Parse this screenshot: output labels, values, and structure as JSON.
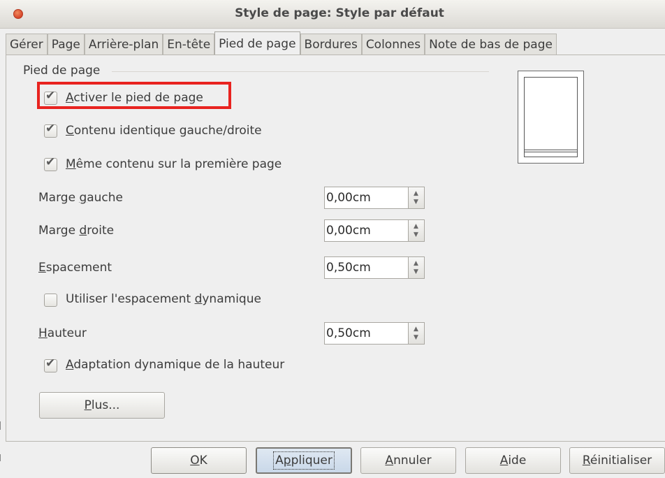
{
  "window": {
    "title": "Style de page: Style par défaut"
  },
  "tabs": [
    {
      "label": "Gérer"
    },
    {
      "label": "Page"
    },
    {
      "label": "Arrière-plan"
    },
    {
      "label": "En-tête"
    },
    {
      "label": "Pied de page"
    },
    {
      "label": "Bordures"
    },
    {
      "label": "Colonnes"
    },
    {
      "label": "Note de bas de page"
    }
  ],
  "active_tab": "Pied de page",
  "footer": {
    "section_label": "Pied de page",
    "activate": {
      "label_mn": "A",
      "label_rest": "ctiver le pied de page",
      "checked": true
    },
    "same_lr": {
      "label_mn": "C",
      "label_rest": "ontenu identique gauche/droite",
      "checked": true
    },
    "same_first": {
      "label_mn": "M",
      "label_rest": "ême contenu sur la première page",
      "checked": true
    },
    "left_margin": {
      "label_pre": "Marge ",
      "label_mn": "g",
      "label_post": "auche",
      "value": "0,00cm"
    },
    "right_margin": {
      "label_pre": "Marge ",
      "label_mn": "d",
      "label_post": "roite",
      "value": "0,00cm"
    },
    "spacing": {
      "label_mn": "E",
      "label_post": "spacement",
      "value": "0,50cm"
    },
    "dynamic_spacing": {
      "label_pre": "Utiliser l'espacement ",
      "label_mn": "d",
      "label_post": "ynamique",
      "checked": false
    },
    "height": {
      "label_mn": "H",
      "label_post": "auteur",
      "value": "0,50cm"
    },
    "autofit": {
      "label_mn": "A",
      "label_post": "daptation dynamique de la hauteur",
      "checked": true
    },
    "more": {
      "label_mn": "P",
      "label_post": "lus..."
    }
  },
  "buttons": {
    "ok": {
      "label_mn": "O",
      "label_post": "K"
    },
    "apply": {
      "label_pre": "A",
      "label_mn": "p",
      "label_post": "pliquer"
    },
    "cancel": {
      "label_mn": "A",
      "label_post": "nnuler"
    },
    "help": {
      "label_mn": "A",
      "label_post": "ide"
    },
    "reset": {
      "label_mn": "R",
      "label_post": "éinitialiser"
    }
  },
  "colors": {
    "highlight": "#e8231f",
    "panel": "#efefef"
  }
}
